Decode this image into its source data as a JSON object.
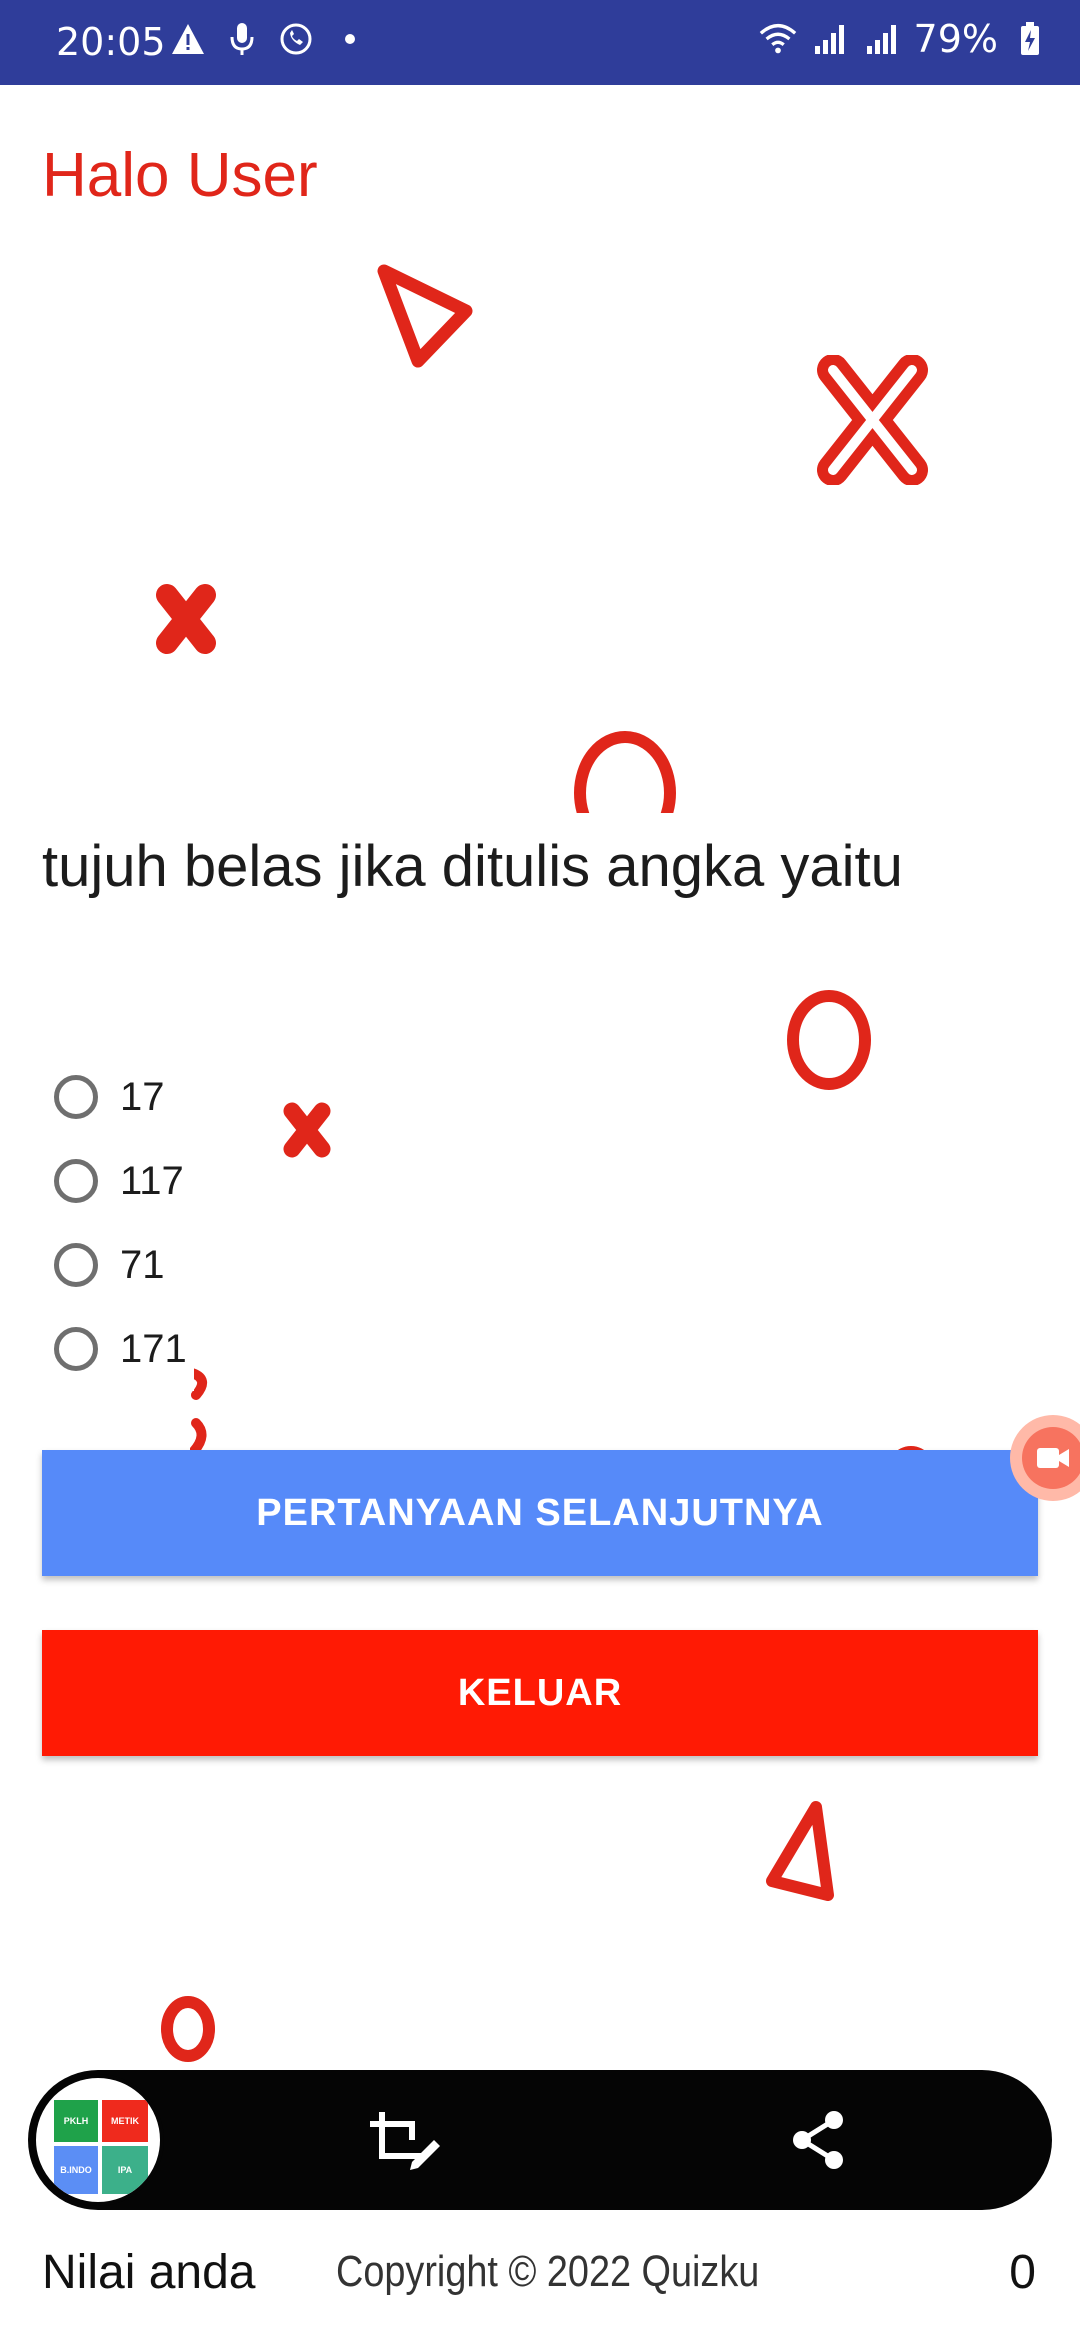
{
  "status_bar": {
    "time": "20:05",
    "battery_percent": "79%",
    "left_icons": [
      "warning-icon",
      "microphone-icon",
      "whatsapp-icon",
      "dot-icon"
    ],
    "right_icons": [
      "wifi-icon",
      "signal-icon",
      "signal-icon",
      "battery-charging-icon"
    ]
  },
  "greeting": "Halo User",
  "quiz": {
    "question": "tujuh belas jika ditulis angka yaitu",
    "options": [
      "17",
      "117",
      "71",
      "171"
    ],
    "selected_index": null
  },
  "buttons": {
    "next_label": "PERTANYAAN SELANJUTNYA",
    "exit_label": "KELUAR"
  },
  "screenshot_toolbar": {
    "thumbnail_tiles": [
      "PKLH",
      "METIK",
      "B.INDO",
      "IPA"
    ],
    "tools": [
      "crop-edit-icon",
      "share-icon"
    ]
  },
  "footer": {
    "score_label": "Nilai anda",
    "copyright": "Copyright © 2022 Quizku",
    "score_value": "0"
  },
  "colors": {
    "status_bar": "#2f3d9a",
    "accent_red": "#e0261a",
    "next_button": "#568af9",
    "exit_button": "#ff1a04"
  }
}
